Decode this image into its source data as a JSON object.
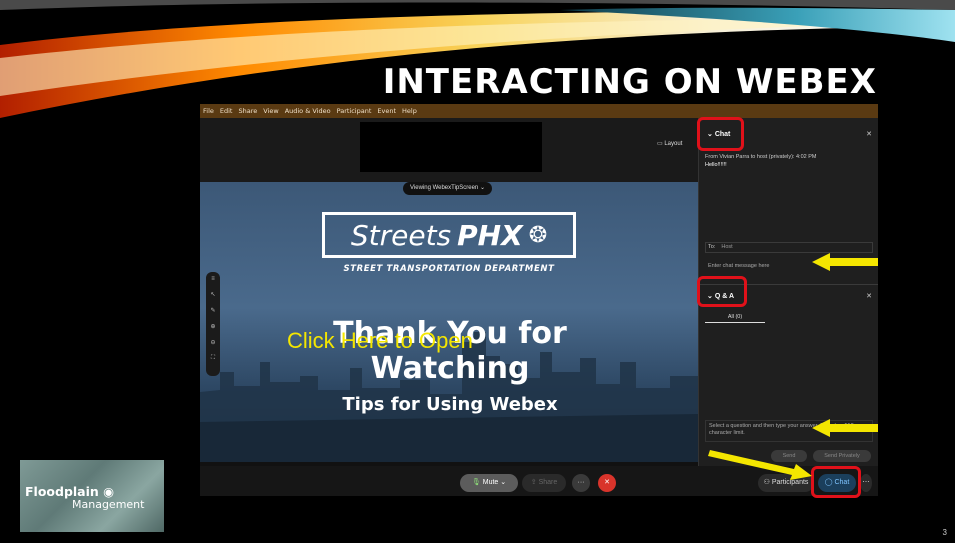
{
  "slide": {
    "title": "INTERACTING ON WEBEX",
    "page_number": "3",
    "annotation": "Click Here to Open",
    "logo_line1": "Floodplain",
    "logo_line2": "Management"
  },
  "menubar": [
    "File",
    "Edit",
    "Share",
    "View",
    "Audio & Video",
    "Participant",
    "Event",
    "Help"
  ],
  "stage": {
    "layout_label": "Layout",
    "viewing_label": "Viewing WebexTipScreen",
    "logo_word1": "Streets",
    "logo_word2": "PHX",
    "logo_dept": "STREET TRANSPORTATION DEPARTMENT",
    "heading": "Thank You for Watching",
    "subheading": "Tips for Using Webex"
  },
  "chat_panel": {
    "title": "Chat",
    "from_line": "From Vivian Parra to host (privately):  4:02 PM",
    "message": "Hello!!!!!!",
    "to_label": "To:",
    "to_value": "Host",
    "input_placeholder": "Enter chat message here"
  },
  "qa_panel": {
    "title": "Q & A",
    "tab_all": "All (0)",
    "input_placeholder": "Select a question and then type your answer. There's a 512-character limit.",
    "send_label": "Send",
    "send_privately_label": "Send Privately"
  },
  "controls": {
    "mute": "Mute",
    "share": "Share",
    "participants": "Participants",
    "chat": "Chat"
  },
  "colors": {
    "annotation_red": "#e0111a",
    "annotation_yellow": "#f4e600",
    "menubar": "#5a3a12"
  }
}
